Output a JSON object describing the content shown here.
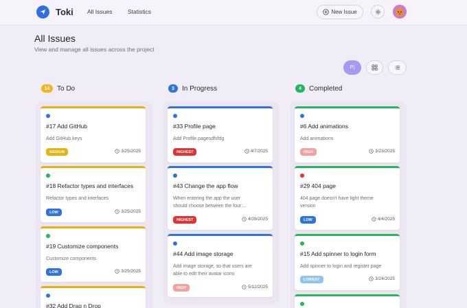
{
  "app": {
    "title": "Toki"
  },
  "nav": {
    "all_issues": "All Issues",
    "statistics": "Statistics"
  },
  "header": {
    "new_issue_label": "New Issue"
  },
  "page": {
    "title": "All Issues",
    "subtitle": "View and manage all issues across the project"
  },
  "views": {
    "kanban": "P|"
  },
  "colors": {
    "todo": "#e7b20d",
    "in_progress": "#2f73e0",
    "completed": "#25b55a",
    "medium": "#e7b20d",
    "low": "#2f73e0",
    "highest": "#e03434",
    "high": "#f4a0a0",
    "lowest": "#8fc3f2"
  },
  "columns": [
    {
      "title": "To Do",
      "count": "14",
      "cards": [
        {
          "title": "#17 Add GitHub",
          "desc": "Add GitHub keys",
          "priority": "MEDIUM",
          "date": "3/25/2025"
        },
        {
          "title": "#18 Refactor types and interfaces",
          "desc": "Refactor types and interfaces",
          "priority": "LOW",
          "date": "3/25/2025"
        },
        {
          "title": "#19 Customize components",
          "desc": "Customize components",
          "priority": "LOW",
          "date": "3/25/2025"
        },
        {
          "title": "#32 Add Drag n Drop"
        }
      ]
    },
    {
      "title": "In Progress",
      "count": "3",
      "cards": [
        {
          "title": "#33 Profile page",
          "desc": "Add Profile pagesdfsfdg",
          "priority": "HIGHEST",
          "date": "4/7/2025"
        },
        {
          "title": "#43 Change the app flow",
          "desc1": "When entering the app the user",
          "desc2": "should choose between the four:...",
          "priority": "HIGHEST",
          "date": "4/28/2025"
        },
        {
          "title": "#44 Add image storage",
          "desc1": "Add image storage, so that users are",
          "desc2": "able to edit their avatar icons",
          "priority": "HIGH",
          "date": "5/12/2025"
        }
      ]
    },
    {
      "title": "Completed",
      "count": "4",
      "cards": [
        {
          "title": "#6 Add animations",
          "desc": "Add animations",
          "priority": "HIGH",
          "date": "3/23/2025"
        },
        {
          "title": "#29 404 page",
          "desc1": "404 page doesn't have light theme",
          "desc2": "version",
          "priority": "LOW",
          "date": "4/4/2025"
        },
        {
          "title": "#15 Add spinner to login form",
          "desc": "Add spinner to login and register page",
          "priority": "LOWEST",
          "date": "3/24/2025"
        }
      ]
    }
  ]
}
